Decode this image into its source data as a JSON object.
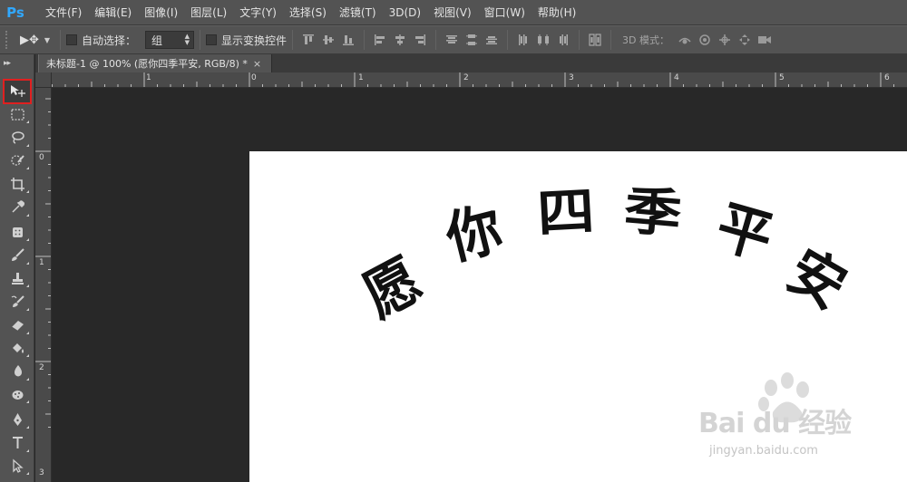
{
  "app": {
    "logo": "Ps"
  },
  "menu": {
    "items": [
      {
        "label": "文件(F)"
      },
      {
        "label": "编辑(E)"
      },
      {
        "label": "图像(I)"
      },
      {
        "label": "图层(L)"
      },
      {
        "label": "文字(Y)"
      },
      {
        "label": "选择(S)"
      },
      {
        "label": "滤镜(T)"
      },
      {
        "label": "3D(D)"
      },
      {
        "label": "视图(V)"
      },
      {
        "label": "窗口(W)"
      },
      {
        "label": "帮助(H)"
      }
    ]
  },
  "options": {
    "auto_select_label": "自动选择：",
    "auto_select_checked": false,
    "auto_select_value": "组",
    "show_transform_label": "显示变换控件",
    "show_transform_checked": false,
    "mode_3d_label": "3D 模式："
  },
  "document_tab": {
    "title": "未标题-1 @ 100% (愿你四季平安, RGB/8) *",
    "close": "×"
  },
  "rulers": {
    "horizontal": [
      "1",
      "0",
      "1",
      "2",
      "3",
      "4",
      "5",
      "6"
    ],
    "vertical": [
      "0",
      "1",
      "2",
      "3"
    ]
  },
  "canvas": {
    "text": "愿你四季平安",
    "chars": [
      "愿",
      "你",
      "四",
      "季",
      "平",
      "安"
    ]
  },
  "watermark": {
    "brand": "Bai du 经验",
    "url": "jingyan.baidu.com"
  },
  "toolbar": {
    "selected_tool": "move-tool",
    "highlight_color": "#e02020"
  },
  "colors": {
    "ui_panel": "#535353",
    "ps_blue": "#31a8ff"
  }
}
